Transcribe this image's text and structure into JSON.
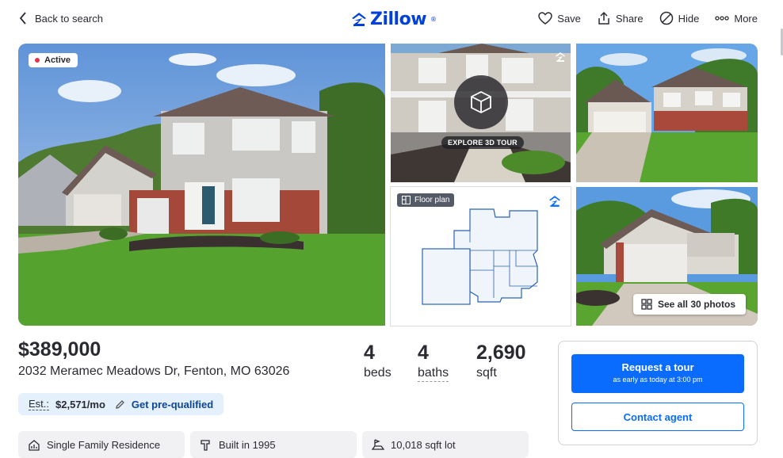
{
  "nav": {
    "back_label": "Back to search",
    "logo": "Zillow",
    "logo_mark": "®",
    "actions": [
      {
        "label": "Save",
        "icon": "heart-icon"
      },
      {
        "label": "Share",
        "icon": "share-icon"
      },
      {
        "label": "Hide",
        "icon": "hide-icon"
      },
      {
        "label": "More",
        "icon": "more-icon"
      }
    ]
  },
  "gallery": {
    "status_badge": "Active",
    "tour_label": "EXPLORE 3D TOUR",
    "floorplan_label": "Floor plan",
    "see_all_label": "See all 30 photos"
  },
  "listing": {
    "price": "$389,000",
    "address": "2032 Meramec Meadows Dr, Fenton, MO 63026",
    "beds": {
      "value": "4",
      "label": "beds"
    },
    "baths": {
      "value": "4",
      "label": "baths"
    },
    "sqft": {
      "value": "2,690",
      "label": "sqft"
    }
  },
  "estimate": {
    "label": "Est.:",
    "amount": "$2,571/mo",
    "link": "Get pre-qualified"
  },
  "facts": [
    {
      "label": "Single Family Residence",
      "icon": "house-chart-icon"
    },
    {
      "label": "Built in 1995",
      "icon": "hammer-icon"
    },
    {
      "label": "10,018 sqft lot",
      "icon": "lot-icon"
    }
  ],
  "contact_card": {
    "tour_button": "Request a tour",
    "tour_sub": "as early as today at 3:00 pm",
    "agent_button": "Contact agent"
  },
  "colors": {
    "brand": "#0041d9",
    "primary_button": "#0a6cff",
    "status_dot": "#e5334a"
  }
}
